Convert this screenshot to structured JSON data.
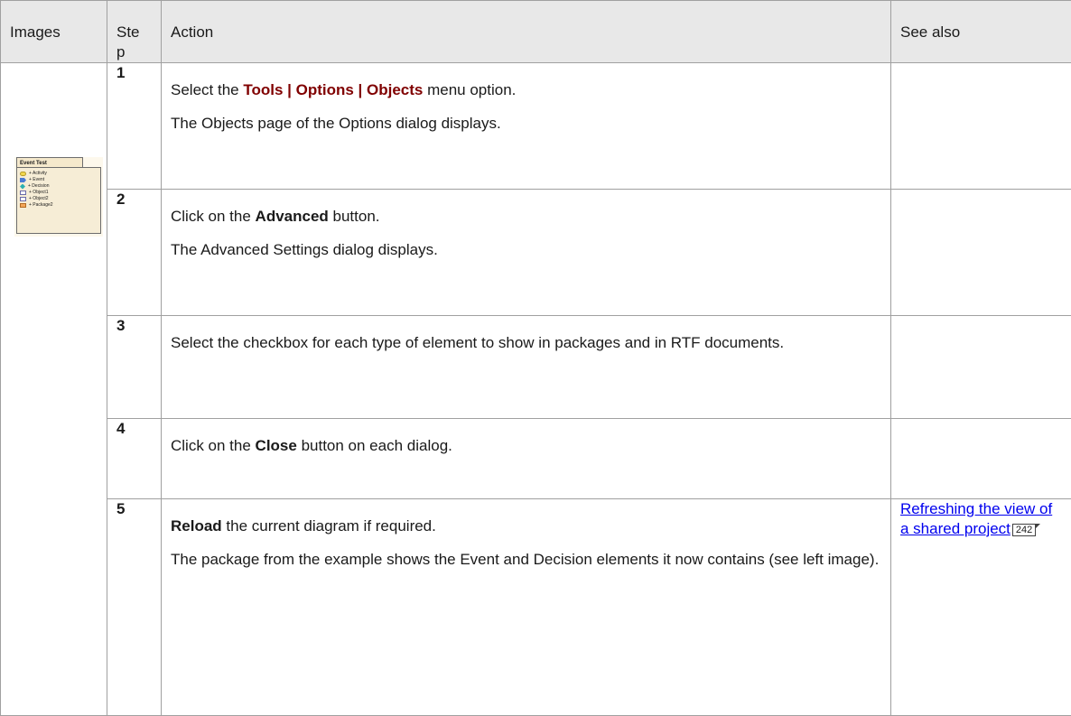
{
  "headers": {
    "images": "Images",
    "step": "Ste p",
    "action": "Action",
    "see_also": "See also"
  },
  "package_image": {
    "title": "Event Test",
    "items": [
      {
        "label": "+ Activity",
        "icon": "activity-icon"
      },
      {
        "label": "+ Event",
        "icon": "event-icon"
      },
      {
        "label": "+ Decision",
        "icon": "decision-icon"
      },
      {
        "label": "+ Object1",
        "icon": "object-icon"
      },
      {
        "label": "+ Object2",
        "icon": "object-icon"
      },
      {
        "label": "+ Package2",
        "icon": "package-icon"
      }
    ]
  },
  "steps": [
    {
      "number": "1",
      "line1": {
        "pre": "Select the ",
        "menu": "Tools | Options | Objects",
        "post": " menu option."
      },
      "line2": "The Objects page of the Options dialog displays."
    },
    {
      "number": "2",
      "line1": {
        "pre": "Click on the ",
        "bold": "Advanced",
        "post": " button."
      },
      "line2": "The Advanced Settings dialog displays."
    },
    {
      "number": "3",
      "line1": {
        "text": "Select the checkbox for each type of element to show in packages and in RTF documents."
      }
    },
    {
      "number": "4",
      "line1": {
        "pre": "Click on the ",
        "bold": "Close",
        "post": " button on each dialog."
      }
    },
    {
      "number": "5",
      "line1": {
        "bold": "Reload",
        "post": " the current diagram if required."
      },
      "line2": "The package from the example shows the Event and Decision elements it now contains (see left image).",
      "see_also": {
        "link": "Refreshing the view of a shared project",
        "page": "242"
      }
    }
  ]
}
